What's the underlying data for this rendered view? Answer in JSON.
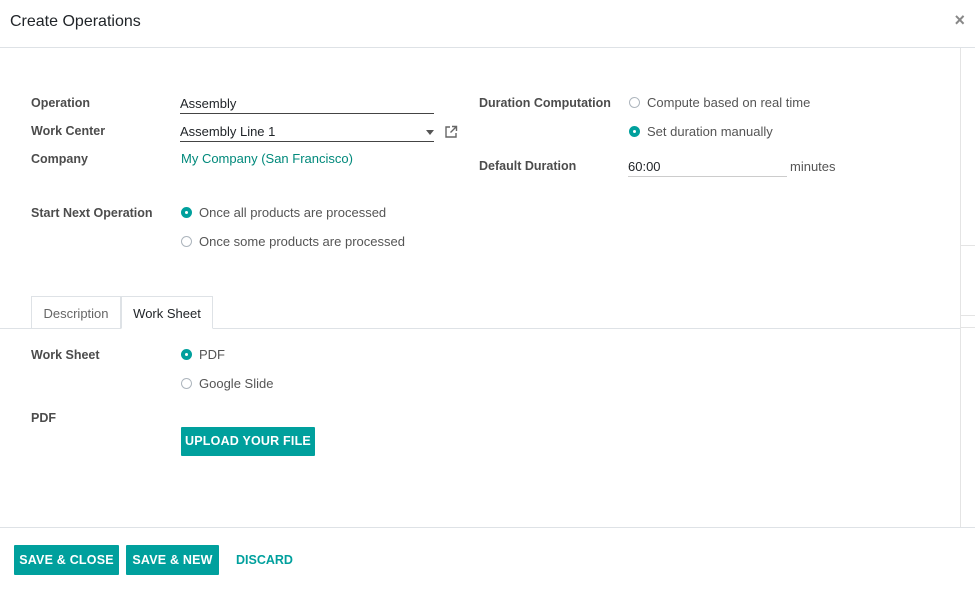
{
  "dialog": {
    "title": "Create Operations",
    "close_glyph": "×"
  },
  "form": {
    "operation_label": "Operation",
    "operation_value": "Assembly",
    "work_center_label": "Work Center",
    "work_center_value": "Assembly Line 1",
    "company_label": "Company",
    "company_value": "My Company (San Francisco)",
    "start_next_label": "Start Next Operation",
    "start_next_options": [
      {
        "label": "Once all products are processed",
        "checked": true
      },
      {
        "label": "Once some products are processed",
        "checked": false
      }
    ],
    "duration_computation_label": "Duration Computation",
    "duration_options": [
      {
        "label": "Compute based on real time",
        "checked": false
      },
      {
        "label": "Set duration manually",
        "checked": true
      }
    ],
    "default_duration_label": "Default Duration",
    "default_duration_value": "60:00",
    "default_duration_unit": "minutes"
  },
  "tabs": [
    {
      "label": "Description",
      "active": false
    },
    {
      "label": "Work Sheet",
      "active": true
    }
  ],
  "worksheet": {
    "work_sheet_label": "Work Sheet",
    "options": [
      {
        "label": "PDF",
        "checked": true
      },
      {
        "label": "Google Slide",
        "checked": false
      }
    ],
    "pdf_label": "PDF",
    "upload_button": "UPLOAD YOUR FILE"
  },
  "footer": {
    "save_close": "SAVE & CLOSE",
    "save_new": "SAVE & NEW",
    "discard": "DISCARD"
  },
  "colors": {
    "accent": "#00a09d",
    "link": "#00897b"
  },
  "icons": {
    "close": "close-icon",
    "external": "external-link-icon",
    "dropdown": "chevron-down-icon"
  }
}
